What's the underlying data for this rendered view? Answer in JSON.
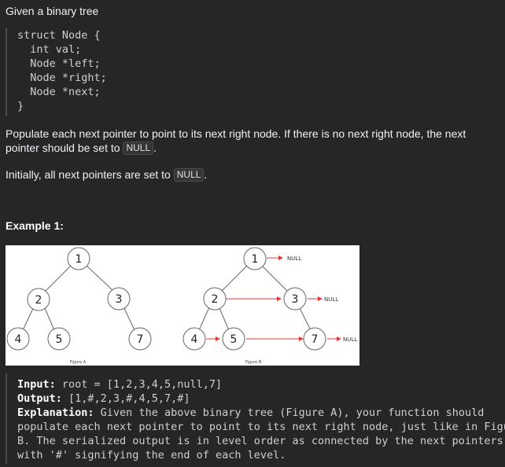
{
  "intro": "Given a binary tree",
  "struct_code": [
    "struct Node {",
    "  int val;",
    "  Node *left;",
    "  Node *right;",
    "  Node *next;",
    "}"
  ],
  "paragraph1": {
    "text": "Populate each next pointer to point to its next right node. If there is no next right node, the next pointer should be set to ",
    "code": "NULL",
    "end": "."
  },
  "paragraph2": {
    "text": "Initially, all next pointers are set to ",
    "code": "NULL",
    "end": "."
  },
  "example_title": "Example 1:",
  "figure": {
    "figure_a_caption": "Figure A",
    "figure_b_caption": "Figure B",
    "tree_a_nodes": [
      "1",
      "2",
      "3",
      "4",
      "5",
      "7"
    ],
    "tree_b_nodes": [
      "1",
      "2",
      "3",
      "4",
      "5",
      "7"
    ],
    "null_label": "NULL",
    "colors": {
      "node_border": "#666666",
      "arrow": "#e53935",
      "background": "#ffffff"
    }
  },
  "example": {
    "input_label": "Input:",
    "input_value": " root = [1,2,3,4,5,null,7]",
    "output_label": "Output:",
    "output_value": " [1,#,2,3,#,4,5,7,#]",
    "explanation_label": "Explanation:",
    "explanation_lines": [
      " Given the above binary tree (Figure A), your function should",
      "populate each next pointer to point to its next right node, just like in Figure",
      "B. The serialized output is in level order as connected by the next pointers,",
      "with '#' signifying the end of each level."
    ]
  }
}
